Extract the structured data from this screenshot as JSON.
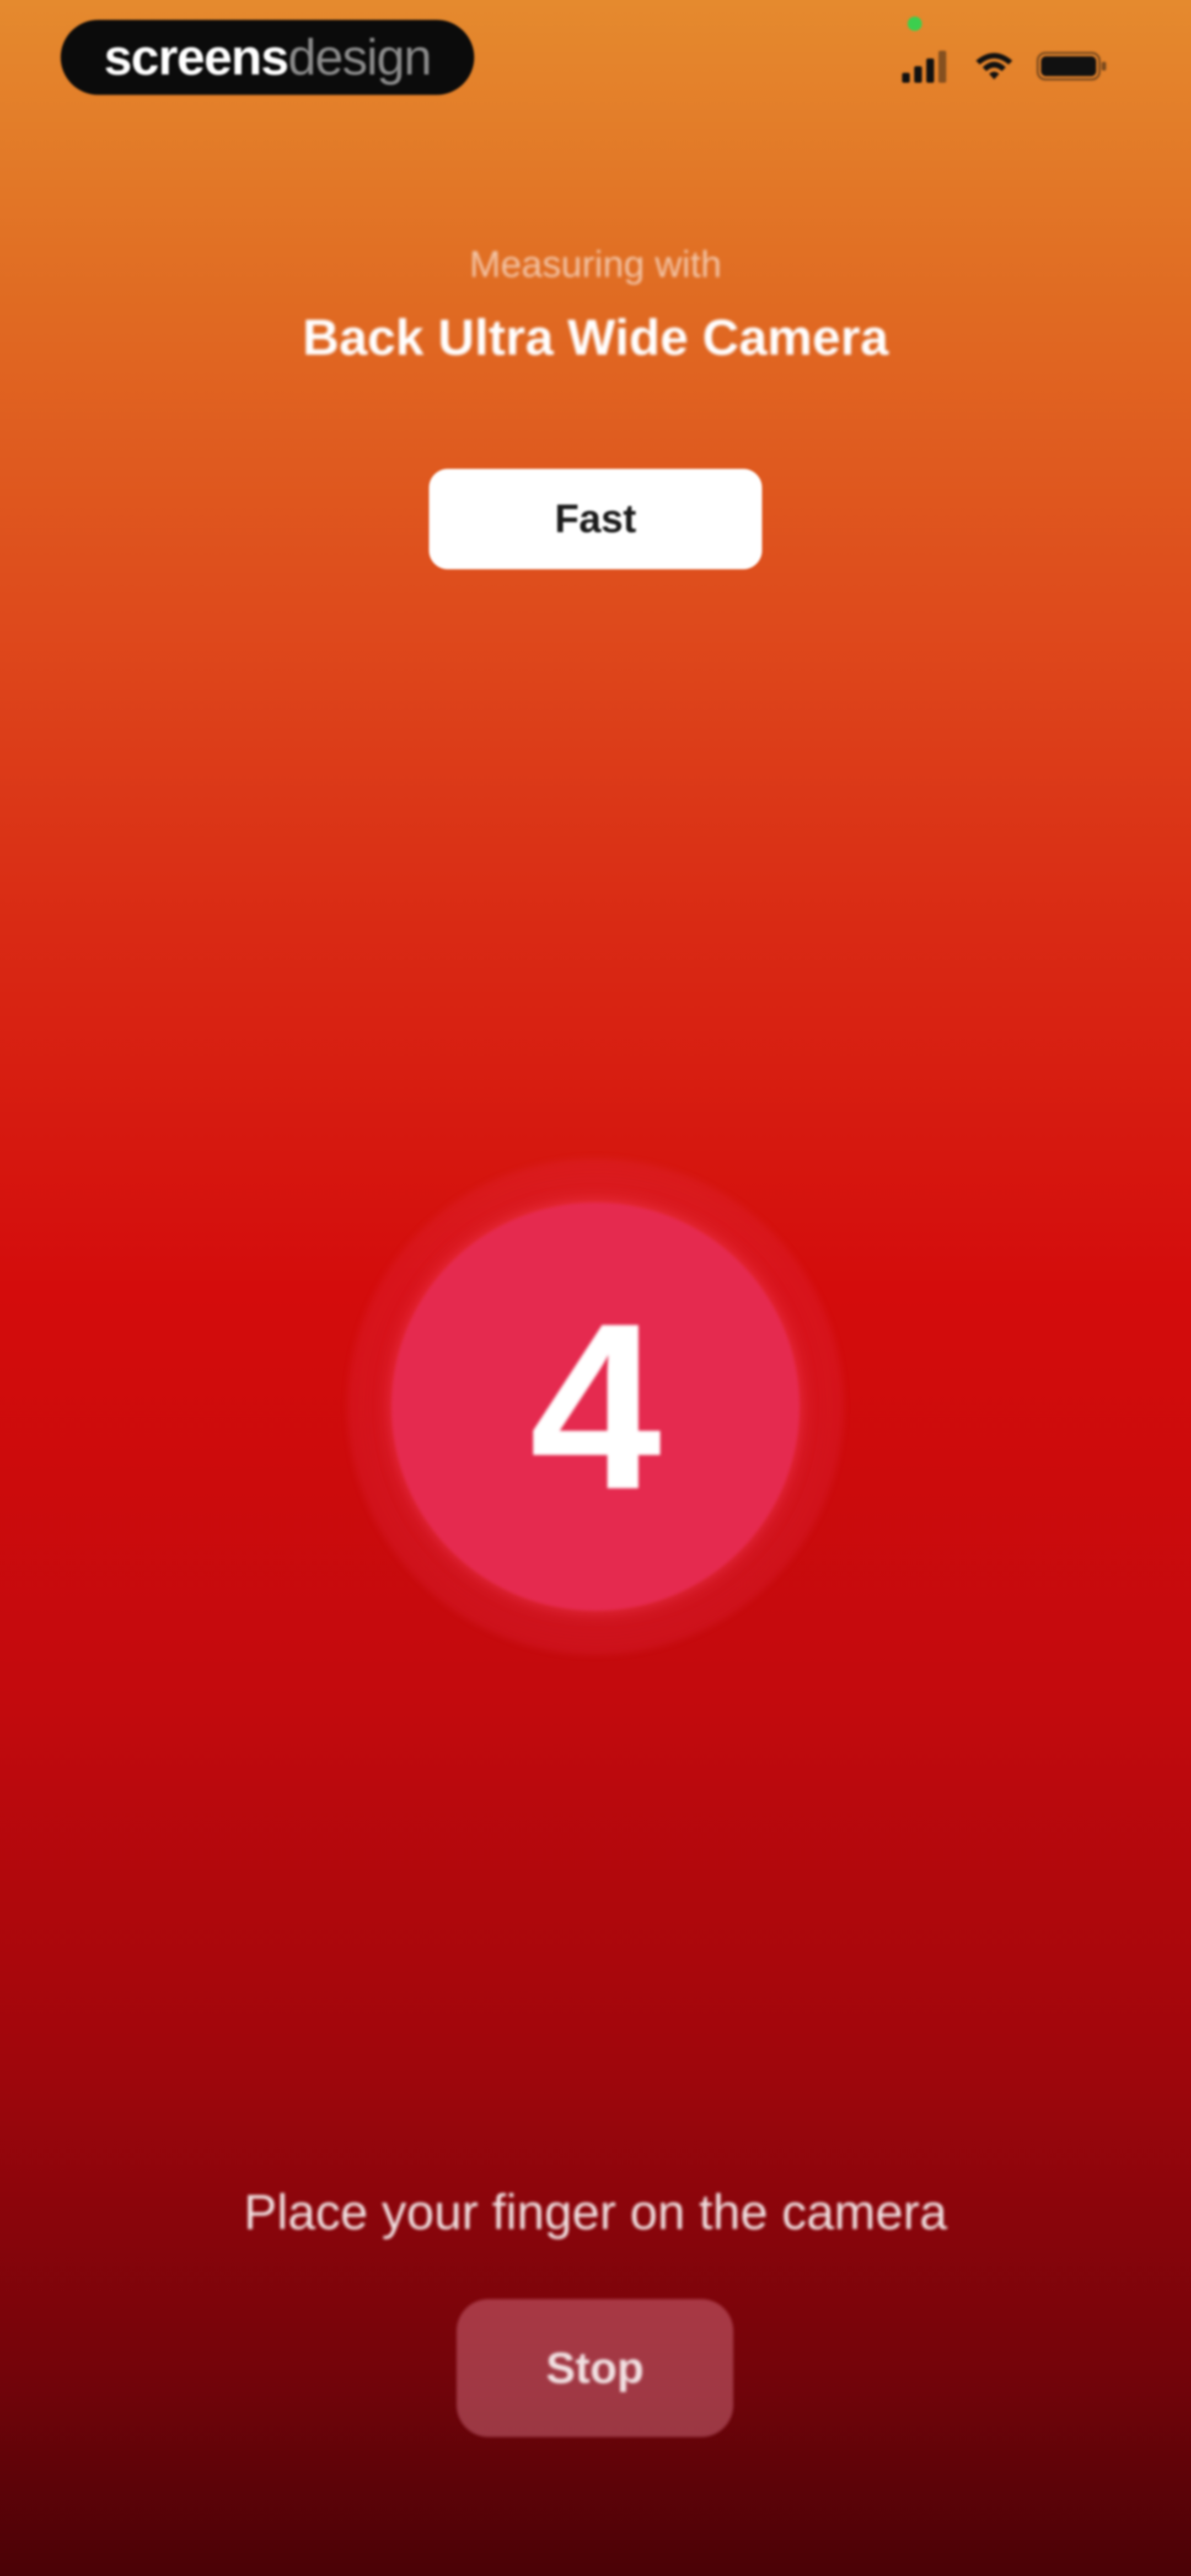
{
  "watermark": {
    "part_bold": "screens",
    "part_light": "design"
  },
  "status_bar": {
    "icons": [
      "cellular-signal-icon",
      "wifi-icon",
      "battery-icon"
    ],
    "camera_indicator_color": "#3ccf4e"
  },
  "header": {
    "measuring_label": "Measuring with",
    "camera_name": "Back Ultra Wide Camera"
  },
  "mode_button": {
    "label": "Fast"
  },
  "countdown": {
    "value": "4"
  },
  "instruction": {
    "text": "Place your finger on the camera"
  },
  "stop_button": {
    "label": "Stop"
  },
  "colors": {
    "gradient_top": "#e58a2e",
    "gradient_mid": "#d40c0c",
    "gradient_bottom": "#4a0206",
    "circle_fill": "#e52a4f"
  }
}
